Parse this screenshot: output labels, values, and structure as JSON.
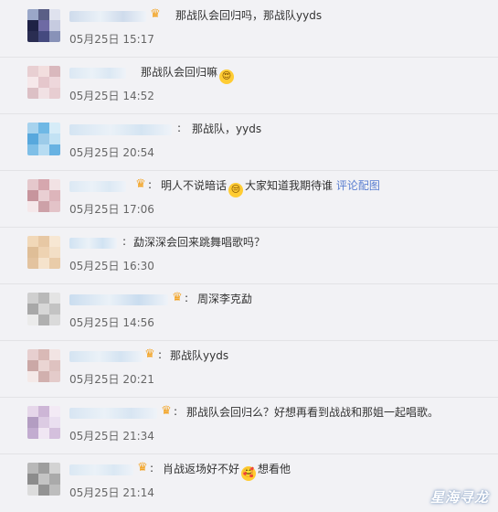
{
  "comments": [
    {
      "id": "c1",
      "text": "那战队会回归吗，那战队yyds",
      "time": "05月25日 15:17",
      "vip": true,
      "sep": "",
      "avatar": [
        "#9aa7c8",
        "#5a5f86",
        "#dfe2ee",
        "#1f2246",
        "#6e6aa4",
        "#c6cbe0",
        "#2a2d52",
        "#454a7f",
        "#8892b8"
      ],
      "name_color": "#c8d7ea"
    },
    {
      "id": "c2",
      "text": "那战队会回归嘛",
      "emoji_after": "😍",
      "time": "05月25日 14:52",
      "vip": false,
      "sep": "",
      "avatar": [
        "#e8cfd2",
        "#f2dede",
        "#d9b8bd",
        "#f6e8ea",
        "#e5c7cc",
        "#eed7db",
        "#dcc0c5",
        "#f1e1e4",
        "#e7cdd1"
      ],
      "name_color": "#d7e6f3"
    },
    {
      "id": "c3",
      "text": "那战队，yyds",
      "time": "05月25日 20:54",
      "vip": false,
      "sep": ":",
      "avatar": [
        "#a7d3ee",
        "#6fb8e5",
        "#d6ecf8",
        "#58a8dd",
        "#9ccbe9",
        "#c2e2f4",
        "#7fbfe7",
        "#b7dcf2",
        "#68b2e2"
      ],
      "name_color": "#cfe2f2"
    },
    {
      "id": "c4",
      "text_before": "明人不说暗话",
      "emoji_mid": "😒",
      "text_after": "大家知道我期待谁",
      "link": "评论配图",
      "time": "05月25日 17:06",
      "vip": true,
      "sep": ":",
      "avatar": [
        "#e5c8cc",
        "#d6a7ae",
        "#f2e2e4",
        "#c7959d",
        "#e9cfd3",
        "#ddb5bb",
        "#f5e8ea",
        "#cda1a8",
        "#e3c3c8"
      ],
      "name_color": "#d8e7f4"
    },
    {
      "id": "c5",
      "text": "勐深深会回来跳舞唱歌吗？",
      "time": "05月25日 16:30",
      "vip": false,
      "sep": ":",
      "avatar": [
        "#f1d8b8",
        "#e7c8a4",
        "#f7e7d3",
        "#dfbe97",
        "#eed3b2",
        "#f3dfc6",
        "#e3c39f",
        "#f5e3cc",
        "#e9cca9"
      ],
      "name_color": "#cbe0f2"
    },
    {
      "id": "c6",
      "text": "周深李克勐",
      "time": "05月25日 14:56",
      "vip": true,
      "sep": ":",
      "avatar": [
        "#cfcfcf",
        "#b9b9b9",
        "#e4e4e4",
        "#a8a8a8",
        "#d7d7d7",
        "#c3c3c3",
        "#ebebeb",
        "#b0b0b0",
        "#dadada"
      ],
      "name_color": "#c3d9ee"
    },
    {
      "id": "c7",
      "text": "那战队yyds",
      "time": "05月25日 20:21",
      "vip": true,
      "sep": ":",
      "avatar": [
        "#e7cfcf",
        "#d9b9b6",
        "#f2e4e3",
        "#cba8a6",
        "#ead5d3",
        "#dec2c0",
        "#f4e9e8",
        "#d1b0ae",
        "#e4cbca"
      ],
      "name_color": "#cfe1f1"
    },
    {
      "id": "c8",
      "text": "那战队会回归么？好想再看到战战和那姐一起唱歌。",
      "time": "05月25日 21:34",
      "vip": true,
      "sep": ":",
      "avatar": [
        "#e6d7ea",
        "#cdb6d6",
        "#f3eaf5",
        "#b39dc2",
        "#dccbe3",
        "#eadff0",
        "#c2acd0",
        "#f0e6f3",
        "#d4c0dd"
      ],
      "name_color": "#d3e3f2"
    },
    {
      "id": "c9",
      "text_before": "肖战返场好不好",
      "emoji_mid": "🥰",
      "text_after": "想看他",
      "time": "05月25日 21:14",
      "vip": true,
      "sep": ":",
      "avatar": [
        "#b8b8b8",
        "#9e9e9e",
        "#d3d3d3",
        "#8c8c8c",
        "#c4c4c4",
        "#aaaaaa",
        "#dcdcdc",
        "#939393",
        "#bdbdbd"
      ],
      "name_color": "#d6e6f3"
    }
  ],
  "watermark": "星海寻龙",
  "icons": {
    "vip": "crown-icon"
  }
}
